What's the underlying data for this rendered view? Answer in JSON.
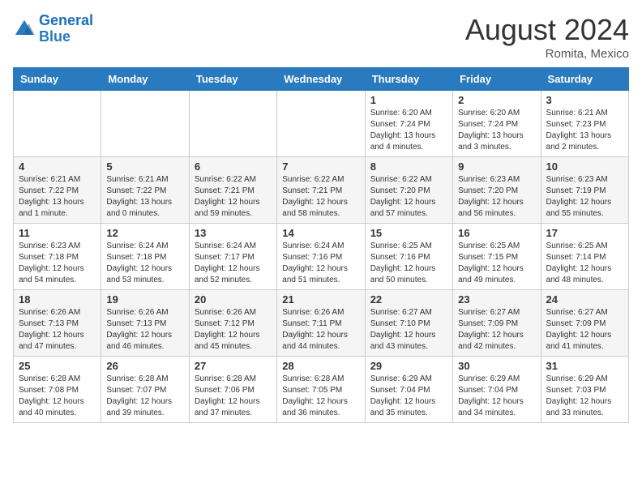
{
  "header": {
    "logo_line1": "General",
    "logo_line2": "Blue",
    "month_year": "August 2024",
    "location": "Romita, Mexico"
  },
  "weekdays": [
    "Sunday",
    "Monday",
    "Tuesday",
    "Wednesday",
    "Thursday",
    "Friday",
    "Saturday"
  ],
  "weeks": [
    [
      {
        "day": "",
        "info": ""
      },
      {
        "day": "",
        "info": ""
      },
      {
        "day": "",
        "info": ""
      },
      {
        "day": "",
        "info": ""
      },
      {
        "day": "1",
        "info": "Sunrise: 6:20 AM\nSunset: 7:24 PM\nDaylight: 13 hours\nand 4 minutes."
      },
      {
        "day": "2",
        "info": "Sunrise: 6:20 AM\nSunset: 7:24 PM\nDaylight: 13 hours\nand 3 minutes."
      },
      {
        "day": "3",
        "info": "Sunrise: 6:21 AM\nSunset: 7:23 PM\nDaylight: 13 hours\nand 2 minutes."
      }
    ],
    [
      {
        "day": "4",
        "info": "Sunrise: 6:21 AM\nSunset: 7:22 PM\nDaylight: 13 hours\nand 1 minute."
      },
      {
        "day": "5",
        "info": "Sunrise: 6:21 AM\nSunset: 7:22 PM\nDaylight: 13 hours\nand 0 minutes."
      },
      {
        "day": "6",
        "info": "Sunrise: 6:22 AM\nSunset: 7:21 PM\nDaylight: 12 hours\nand 59 minutes."
      },
      {
        "day": "7",
        "info": "Sunrise: 6:22 AM\nSunset: 7:21 PM\nDaylight: 12 hours\nand 58 minutes."
      },
      {
        "day": "8",
        "info": "Sunrise: 6:22 AM\nSunset: 7:20 PM\nDaylight: 12 hours\nand 57 minutes."
      },
      {
        "day": "9",
        "info": "Sunrise: 6:23 AM\nSunset: 7:20 PM\nDaylight: 12 hours\nand 56 minutes."
      },
      {
        "day": "10",
        "info": "Sunrise: 6:23 AM\nSunset: 7:19 PM\nDaylight: 12 hours\nand 55 minutes."
      }
    ],
    [
      {
        "day": "11",
        "info": "Sunrise: 6:23 AM\nSunset: 7:18 PM\nDaylight: 12 hours\nand 54 minutes."
      },
      {
        "day": "12",
        "info": "Sunrise: 6:24 AM\nSunset: 7:18 PM\nDaylight: 12 hours\nand 53 minutes."
      },
      {
        "day": "13",
        "info": "Sunrise: 6:24 AM\nSunset: 7:17 PM\nDaylight: 12 hours\nand 52 minutes."
      },
      {
        "day": "14",
        "info": "Sunrise: 6:24 AM\nSunset: 7:16 PM\nDaylight: 12 hours\nand 51 minutes."
      },
      {
        "day": "15",
        "info": "Sunrise: 6:25 AM\nSunset: 7:16 PM\nDaylight: 12 hours\nand 50 minutes."
      },
      {
        "day": "16",
        "info": "Sunrise: 6:25 AM\nSunset: 7:15 PM\nDaylight: 12 hours\nand 49 minutes."
      },
      {
        "day": "17",
        "info": "Sunrise: 6:25 AM\nSunset: 7:14 PM\nDaylight: 12 hours\nand 48 minutes."
      }
    ],
    [
      {
        "day": "18",
        "info": "Sunrise: 6:26 AM\nSunset: 7:13 PM\nDaylight: 12 hours\nand 47 minutes."
      },
      {
        "day": "19",
        "info": "Sunrise: 6:26 AM\nSunset: 7:13 PM\nDaylight: 12 hours\nand 46 minutes."
      },
      {
        "day": "20",
        "info": "Sunrise: 6:26 AM\nSunset: 7:12 PM\nDaylight: 12 hours\nand 45 minutes."
      },
      {
        "day": "21",
        "info": "Sunrise: 6:26 AM\nSunset: 7:11 PM\nDaylight: 12 hours\nand 44 minutes."
      },
      {
        "day": "22",
        "info": "Sunrise: 6:27 AM\nSunset: 7:10 PM\nDaylight: 12 hours\nand 43 minutes."
      },
      {
        "day": "23",
        "info": "Sunrise: 6:27 AM\nSunset: 7:09 PM\nDaylight: 12 hours\nand 42 minutes."
      },
      {
        "day": "24",
        "info": "Sunrise: 6:27 AM\nSunset: 7:09 PM\nDaylight: 12 hours\nand 41 minutes."
      }
    ],
    [
      {
        "day": "25",
        "info": "Sunrise: 6:28 AM\nSunset: 7:08 PM\nDaylight: 12 hours\nand 40 minutes."
      },
      {
        "day": "26",
        "info": "Sunrise: 6:28 AM\nSunset: 7:07 PM\nDaylight: 12 hours\nand 39 minutes."
      },
      {
        "day": "27",
        "info": "Sunrise: 6:28 AM\nSunset: 7:06 PM\nDaylight: 12 hours\nand 37 minutes."
      },
      {
        "day": "28",
        "info": "Sunrise: 6:28 AM\nSunset: 7:05 PM\nDaylight: 12 hours\nand 36 minutes."
      },
      {
        "day": "29",
        "info": "Sunrise: 6:29 AM\nSunset: 7:04 PM\nDaylight: 12 hours\nand 35 minutes."
      },
      {
        "day": "30",
        "info": "Sunrise: 6:29 AM\nSunset: 7:04 PM\nDaylight: 12 hours\nand 34 minutes."
      },
      {
        "day": "31",
        "info": "Sunrise: 6:29 AM\nSunset: 7:03 PM\nDaylight: 12 hours\nand 33 minutes."
      }
    ]
  ]
}
